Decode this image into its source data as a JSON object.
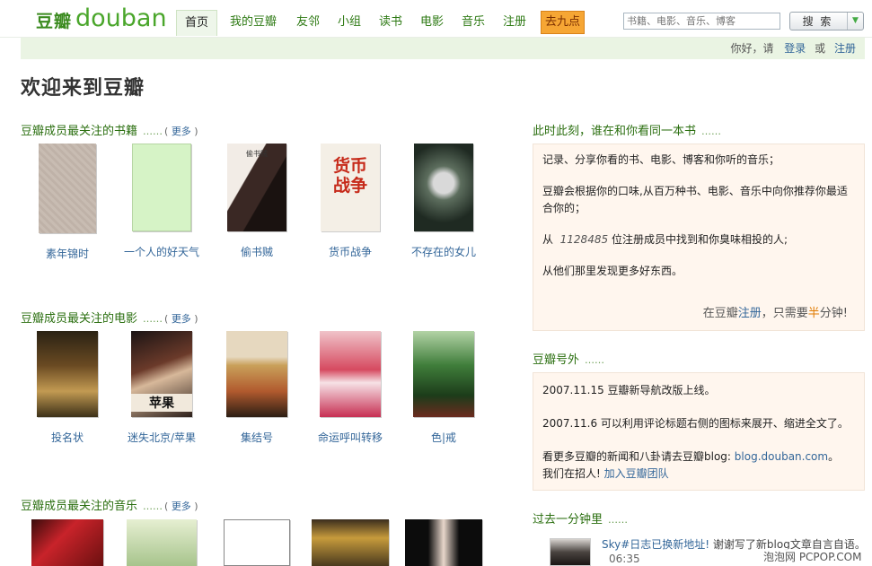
{
  "logo": {
    "cn": "豆瓣",
    "en": "douban"
  },
  "nav": {
    "items": [
      "首页",
      "我的豆瓣",
      "友邻",
      "小组",
      "读书",
      "电影",
      "音乐",
      "注册",
      "去九点"
    ]
  },
  "search": {
    "placeholder": "书籍、电影、音乐、博客",
    "button": "搜 索"
  },
  "userbar": {
    "greeting": "你好，请",
    "login": "登录",
    "or": "或",
    "register": "注册"
  },
  "welcome": "欢迎来到豆瓣",
  "more_label": "更多",
  "books": {
    "title": "豆瓣成员最关注的书籍",
    "items": [
      "素年锦时",
      "一个人的好天气",
      "偷书贼",
      "货币战争",
      "不存在的女儿"
    ]
  },
  "movies": {
    "title": "豆瓣成员最关注的电影",
    "items": [
      "投名状",
      "迷失北京/苹果",
      "集结号",
      "命运呼叫转移",
      "色|戒"
    ]
  },
  "music": {
    "title": "豆瓣成员最关注的音乐"
  },
  "cover_text": {
    "b3": "偷书贼",
    "b4": "货币战争",
    "m2": "苹果"
  },
  "intro": {
    "title": "此时此刻，谁在和你看同一本书",
    "p1": "记录、分享你看的书、电影、博客和你听的音乐；",
    "p2": "豆瓣会根据你的口味,从百万种书、电影、音乐中向你推荐你最适合你的；",
    "p3_pre": "从",
    "p3_num": "1128485",
    "p3_post": "位注册成员中找到和你臭味相投的人;",
    "p4": "从他们那里发现更多好东西。",
    "join_pre": "在豆瓣",
    "join_reg": "注册",
    "join_mid": "，只需要",
    "join_half": "半",
    "join_post": "分钟!"
  },
  "news": {
    "title": "豆瓣号外",
    "l1": "2007.11.15 豆瓣新导航改版上线。",
    "l2": "2007.11.6 可以利用评论标题右侧的图标来展开、缩进全文了。",
    "l3_pre": "看更多豆瓣的新闻和八卦请去豆瓣blog: ",
    "l3_link": "blog.douban.com",
    "l3_post": "。",
    "l4_pre": "我们在招人! ",
    "l4_link": "加入豆瓣团队"
  },
  "recent": {
    "title": "过去一分钟里",
    "user": "Sky#日志已换新地址!",
    "text": " 谢谢写了新blog文章自言自语。",
    "time": "06:35"
  },
  "watermark": "泡泡网 PCPOP.COM"
}
